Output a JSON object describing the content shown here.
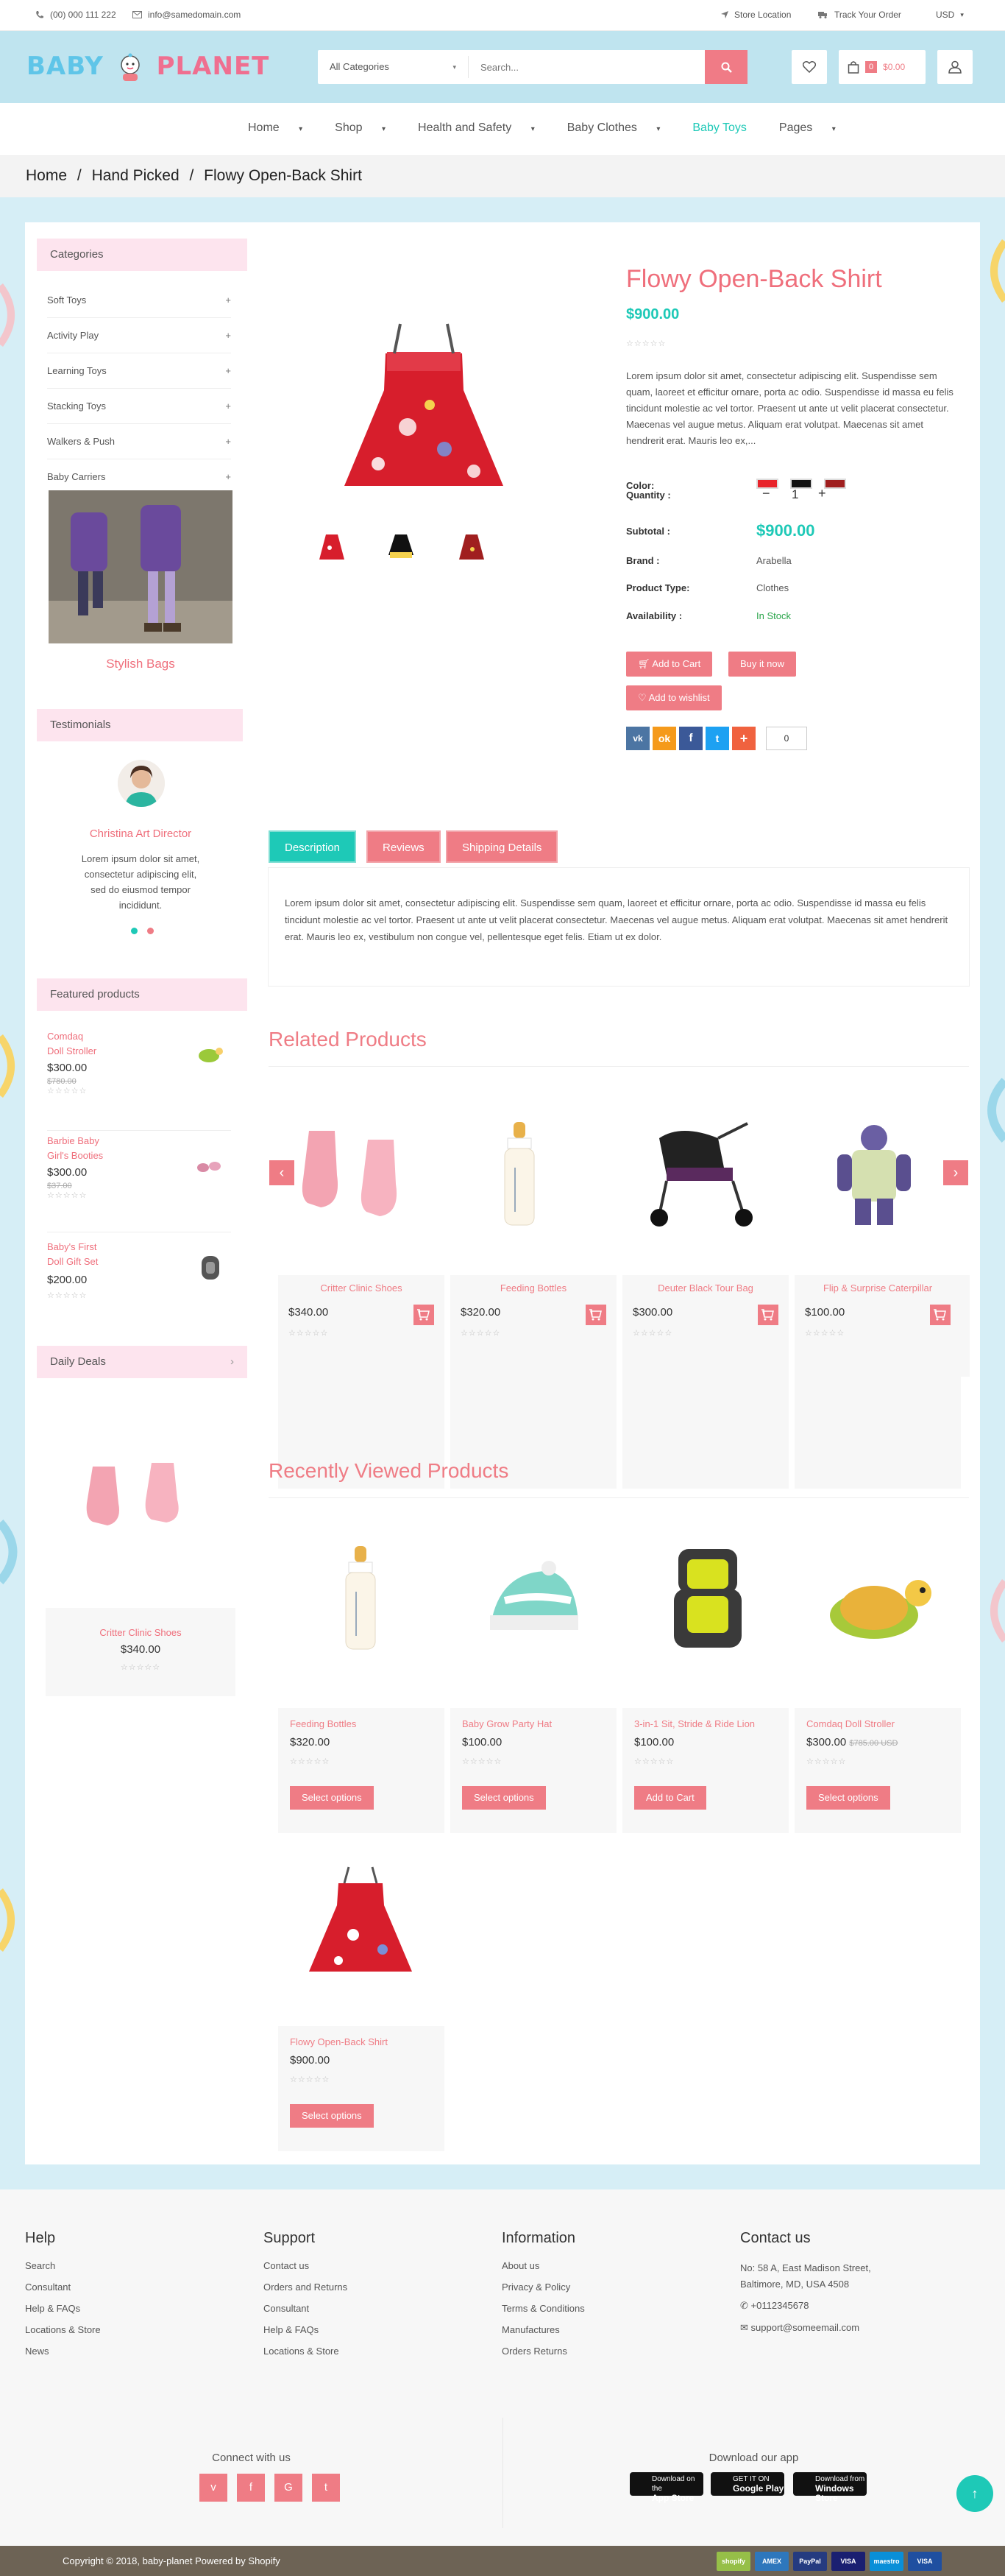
{
  "topbar": {
    "phone": "(00) 000 111 222",
    "email": "info@samedomain.com",
    "store_location": "Store Location",
    "track_order": "Track Your Order",
    "currency": "USD"
  },
  "header": {
    "logo_part1": "BABY",
    "logo_part2": "PLANET",
    "search_category": "All Categories",
    "search_placeholder": "Search...",
    "cart_count": "0",
    "cart_total": "$0.00"
  },
  "nav": {
    "items": [
      "Home",
      "Shop",
      "Health and Safety",
      "Baby Clothes",
      "Baby Toys",
      "Pages"
    ]
  },
  "breadcrumb": {
    "home": "Home",
    "sep": "/",
    "parent": "Hand Picked",
    "current": "Flowy Open-Back Shirt"
  },
  "sidebar": {
    "categories_title": "Categories",
    "categories": [
      "Soft Toys",
      "Activity Play",
      "Learning Toys",
      "Stacking Toys",
      "Walkers & Push",
      "Baby Carriers"
    ],
    "banner_title": "Stylish Bags",
    "testimonials_title": "Testimonials",
    "testimonial_name": "Christina Art Director",
    "testimonial_text": "Lorem ipsum dolor sit amet, consectetur adipiscing elit, sed do eiusmod tempor incididunt.",
    "featured_title": "Featured products",
    "featured": [
      {
        "name_l1": "Comdaq",
        "name_l2": "Doll Stroller",
        "price": "$300.00",
        "old": "$780.00"
      },
      {
        "name_l1": "Barbie Baby",
        "name_l2": "Girl's Booties",
        "price": "$300.00",
        "old": "$37.00"
      },
      {
        "name_l1": "Baby's First",
        "name_l2": "Doll Gift Set",
        "price": "$200.00",
        "old": ""
      }
    ],
    "daily_deals_title": "Daily Deals",
    "deal": {
      "name": "Critter Clinic Shoes",
      "price": "$340.00"
    }
  },
  "product": {
    "title": "Flowy Open-Back Shirt",
    "price": "$900.00",
    "description": "Lorem ipsum dolor sit amet, consectetur adipiscing elit. Suspendisse sem quam, laoreet et efficitur ornare, porta ac odio. Suspendisse id massa eu felis tincidunt molestie ac vel tortor. Praesent ut ante ut velit placerat consectetur. Maecenas vel augue metus. Aliquam erat volutpat. Maecenas sit amet hendrerit erat. Mauris leo ex,...",
    "color_label": "Color:",
    "quantity_label": "Quantity :",
    "quantity": "1",
    "subtotal_label": "Subtotal :",
    "subtotal": "$900.00",
    "brand_label": "Brand :",
    "brand": "Arabella",
    "type_label": "Product Type:",
    "type": "Clothes",
    "availability_label": "Availability :",
    "availability": "In Stock",
    "add_to_cart": "Add to Cart",
    "buy_now": "Buy it now",
    "add_to_wishlist": "Add to wishlist",
    "share_count": "0",
    "swatches": [
      "#e8232a",
      "#111111",
      "#a01f1f"
    ]
  },
  "tabs": {
    "labels": [
      "Description",
      "Reviews",
      "Shipping Details"
    ],
    "description": "Lorem ipsum dolor sit amet, consectetur adipiscing elit. Suspendisse sem quam, laoreet et efficitur ornare, porta ac odio. Suspendisse id massa eu felis tincidunt molestie ac vel tortor. Praesent ut ante ut velit placerat consectetur. Maecenas vel augue metus. Aliquam erat volutpat. Maecenas sit amet hendrerit erat. Mauris leo ex, vestibulum non congue vel, pellentesque eget felis. Etiam ut ex dolor."
  },
  "related": {
    "title": "Related Products",
    "items": [
      {
        "name": "Critter Clinic Shoes",
        "price": "$340.00"
      },
      {
        "name": "Feeding Bottles",
        "price": "$320.00"
      },
      {
        "name": "Deuter Black Tour Bag",
        "price": "$300.00"
      },
      {
        "name": "Flip & Surprise Caterpillar",
        "price": "$100.00"
      }
    ]
  },
  "recent": {
    "title": "Recently Viewed Products",
    "items": [
      {
        "name": "Feeding Bottles",
        "price": "$320.00",
        "old": "",
        "button": "Select options"
      },
      {
        "name": "Baby Grow Party Hat",
        "price": "$100.00",
        "old": "",
        "button": "Select options"
      },
      {
        "name": "3-in-1 Sit, Stride & Ride Lion",
        "price": "$100.00",
        "old": "",
        "button": "Add to Cart"
      },
      {
        "name": "Comdaq Doll Stroller",
        "price": "$300.00",
        "old": "$785.00 USD",
        "button": "Select options"
      },
      {
        "name": "Flowy Open-Back Shirt",
        "price": "$900.00",
        "old": "",
        "button": "Select options"
      }
    ]
  },
  "footer": {
    "help_title": "Help",
    "help": [
      "Search",
      "Consultant",
      "Help & FAQs",
      "Locations & Store",
      "News"
    ],
    "support_title": "Support",
    "support": [
      "Contact us",
      "Orders and Returns",
      "Consultant",
      "Help & FAQs",
      "Locations & Store"
    ],
    "info_title": "Information",
    "info": [
      "About us",
      "Privacy & Policy",
      "Terms & Conditions",
      "Manufactures",
      "Orders Returns"
    ],
    "contact_title": "Contact us",
    "address_l1": "No: 58 A, East Madison Street,",
    "address_l2": "Baltimore, MD, USA 4508",
    "phone": "+0112345678",
    "email": "support@someemail.com",
    "connect_title": "Connect with us",
    "social": [
      "v",
      "f",
      "G",
      "t"
    ],
    "app_title": "Download our app",
    "apps": [
      {
        "top": "Download on the",
        "bottom": "App Store"
      },
      {
        "top": "GET IT ON",
        "bottom": "Google Play"
      },
      {
        "top": "Download from",
        "bottom": "Windows Store"
      }
    ],
    "copyright": "Copyright © 2018, baby-planet Powered by Shopify",
    "payments": [
      "shopify",
      "AMEX",
      "PayPal",
      "VISA",
      "maestro",
      "VISA"
    ]
  }
}
